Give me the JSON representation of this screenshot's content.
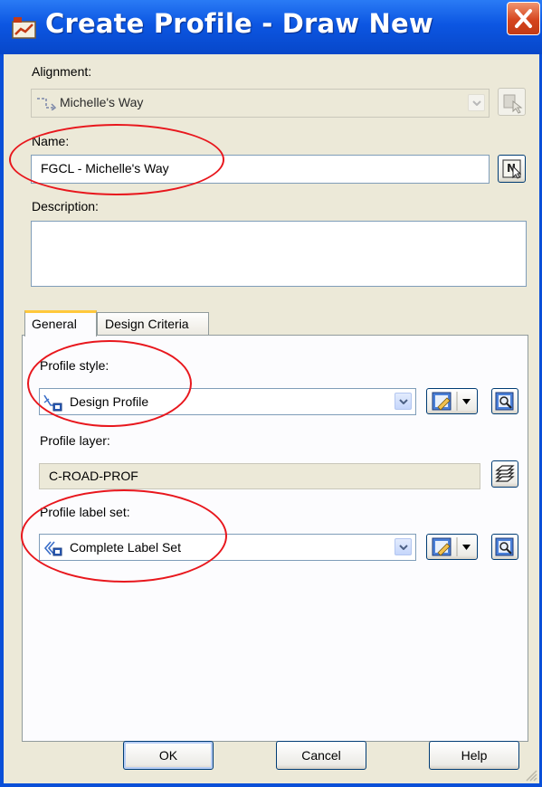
{
  "window": {
    "title": "Create Profile - Draw New"
  },
  "alignment": {
    "label": "Alignment:",
    "value": "Michelle's Way"
  },
  "name": {
    "label": "Name:",
    "value": "FGCL - Michelle's Way"
  },
  "description": {
    "label": "Description:",
    "value": ""
  },
  "tabs": [
    {
      "label": "General",
      "active": true
    },
    {
      "label": "Design Criteria",
      "active": false
    }
  ],
  "general": {
    "profile_style": {
      "label": "Profile style:",
      "value": "Design Profile"
    },
    "profile_layer": {
      "label": "Profile layer:",
      "value": "C-ROAD-PROF"
    },
    "profile_label_set": {
      "label": "Profile label set:",
      "value": "Complete Label Set"
    }
  },
  "buttons": {
    "ok": "OK",
    "cancel": "Cancel",
    "help": "Help"
  },
  "colors": {
    "title_bar": "#0a4fd8",
    "dialog_bg": "#ece9d8",
    "annotation": "#e8171d",
    "close_button": "#d5451e"
  }
}
